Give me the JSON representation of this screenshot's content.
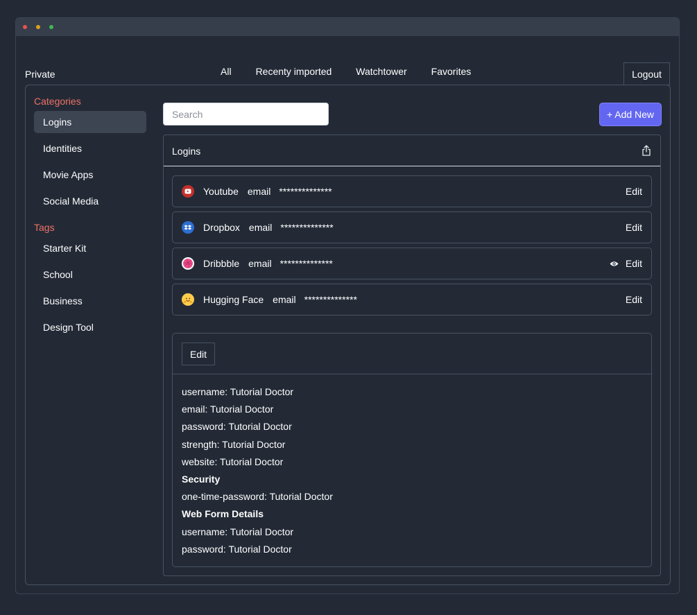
{
  "window": {
    "traffic_lights": [
      "#e5534b",
      "#d8a21f",
      "#3fb950"
    ]
  },
  "header": {
    "brand": "Private",
    "tabs": [
      "All",
      "Recenty imported",
      "Watchtower",
      "Favorites"
    ],
    "logout_label": "Logout"
  },
  "sidebar": {
    "categories_heading": "Categories",
    "categories": [
      {
        "label": "Logins",
        "active": true
      },
      {
        "label": "Identities"
      },
      {
        "label": "Movie Apps"
      },
      {
        "label": "Social Media"
      }
    ],
    "tags_heading": "Tags",
    "tags": [
      {
        "label": "Starter Kit"
      },
      {
        "label": "School"
      },
      {
        "label": "Business"
      },
      {
        "label": "Design Tool"
      }
    ]
  },
  "toolbar": {
    "search_placeholder": "Search",
    "add_new_label": "+ Add New"
  },
  "panel": {
    "title": "Logins",
    "share_icon": "share-icon"
  },
  "logins": [
    {
      "name": "Youtube",
      "field": "email",
      "password": "**************",
      "edit": "Edit",
      "icon": "youtube-icon",
      "color": "#c4302b"
    },
    {
      "name": "Dropbox",
      "field": "email",
      "password": "**************",
      "edit": "Edit",
      "icon": "dropbox-icon",
      "color": "#2d6fd2"
    },
    {
      "name": "Dribbble",
      "field": "email",
      "password": "**************",
      "edit": "Edit",
      "icon": "dribbble-icon",
      "color": "#ea4c89",
      "show_eye": true
    },
    {
      "name": "Hugging Face",
      "field": "email",
      "password": "**************",
      "edit": "Edit",
      "icon": "hugging-face-icon",
      "color": "#ffcc4d"
    }
  ],
  "detail": {
    "edit_label": "Edit",
    "lines": [
      {
        "text": "username: Tutorial Doctor"
      },
      {
        "text": "email: Tutorial Doctor"
      },
      {
        "text": "password: Tutorial Doctor"
      },
      {
        "text": "strength: Tutorial Doctor"
      },
      {
        "text": "website: Tutorial Doctor"
      },
      {
        "text": "Security",
        "bold": true
      },
      {
        "text": "one-time-password: Tutorial Doctor"
      },
      {
        "text": "Web Form Details",
        "bold": true
      },
      {
        "text": "username: Tutorial Doctor"
      },
      {
        "text": "password: Tutorial Doctor"
      }
    ]
  },
  "colors": {
    "background": "#232a36",
    "accent": "#6366f1",
    "section_heading": "#ee7166"
  }
}
